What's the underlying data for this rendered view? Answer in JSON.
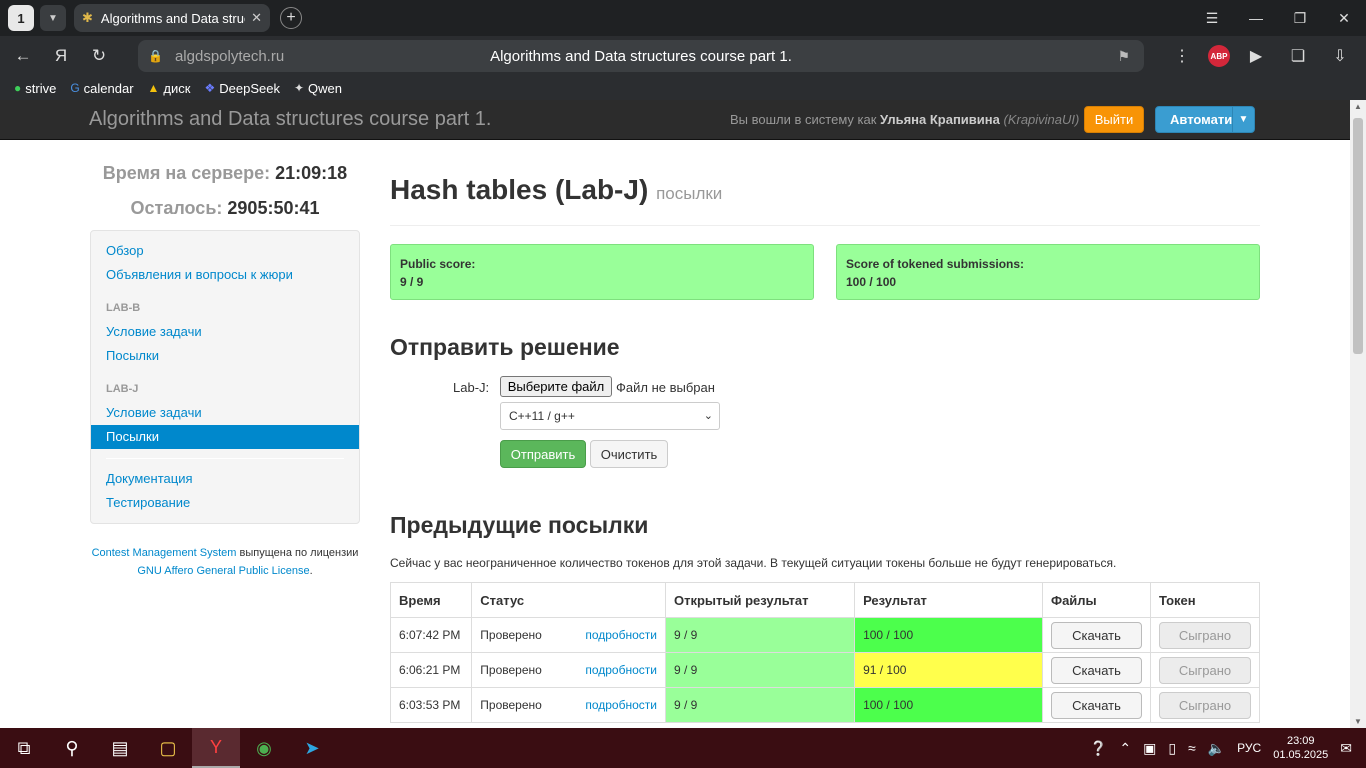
{
  "browser": {
    "tab_count": "1",
    "tab_title": "Algorithms and Data structures course part 1.",
    "domain": "algdspolytech.ru",
    "page_title": "Algorithms and Data structures course part 1.",
    "abp_label": "ABP",
    "bookmarks": [
      {
        "label": "strive",
        "icon": "strive-icon"
      },
      {
        "label": "calendar",
        "icon": "google-icon"
      },
      {
        "label": "диск",
        "icon": "drive-icon"
      },
      {
        "label": "DeepSeek",
        "icon": "deepseek-icon"
      },
      {
        "label": "Qwen",
        "icon": "qwen-icon"
      }
    ]
  },
  "navbar": {
    "brand": "Algorithms and Data structures course part 1.",
    "login_prefix": "Вы вошли в систему как",
    "user_name": "Ульяна Крапивина",
    "user_login": "(KrapivinaUI)",
    "logout": "Выйти",
    "auto": "Автомати"
  },
  "sidebar": {
    "server_time_label": "Время на сервере:",
    "server_time": "21:09:18",
    "remaining_label": "Осталось:",
    "remaining": "2905:50:41",
    "overview": "Обзор",
    "announcements": "Объявления и вопросы к жюри",
    "lab_b_header": "LAB-B",
    "lab_b_statement": "Условие задачи",
    "lab_b_submissions": "Посылки",
    "lab_j_header": "LAB-J",
    "lab_j_statement": "Условие задачи",
    "lab_j_submissions": "Посылки",
    "documentation": "Документация",
    "testing": "Тестирование",
    "footer_link1": "Contest Management System",
    "footer_text1": "выпущена по лицензии",
    "footer_link2": "GNU Affero General Public License",
    "footer_text2": "."
  },
  "main": {
    "title": "Hash tables (Lab-J)",
    "subtitle": "посылки",
    "public_score_label": "Public score:",
    "public_score": "9 / 9",
    "tokened_score_label": "Score of tokened submissions:",
    "tokened_score": "100 / 100",
    "submit_heading": "Отправить решение",
    "lab_label": "Lab-J:",
    "choose_file": "Выберите файл",
    "no_file": "Файл не выбран",
    "language": "C++11 / g++",
    "submit": "Отправить",
    "clear": "Очистить",
    "previous_heading": "Предыдущие посылки",
    "tokens_info": "Сейчас у вас неограниченное количество токенов для этой задачи. В текущей ситуации токены больше не будут генерироваться."
  },
  "table": {
    "headers": [
      "Время",
      "Статус",
      "Открытый результат",
      "Результат",
      "Файлы",
      "Токен"
    ],
    "rows": [
      {
        "time": "6:07:42 PM",
        "status": "Проверено",
        "details": "подробности",
        "public": "9 / 9",
        "result": "100 / 100",
        "download": "Скачать",
        "token": "Сыграно"
      },
      {
        "time": "6:06:21 PM",
        "status": "Проверено",
        "details": "подробности",
        "public": "9 / 9",
        "result": "91 / 100",
        "download": "Скачать",
        "token": "Сыграно"
      },
      {
        "time": "6:03:53 PM",
        "status": "Проверено",
        "details": "подробности",
        "public": "9 / 9",
        "result": "100 / 100",
        "download": "Скачать",
        "token": "Сыграно"
      }
    ]
  },
  "taskbar": {
    "lang": "РУС",
    "time": "23:09",
    "date": "01.05.2025"
  }
}
